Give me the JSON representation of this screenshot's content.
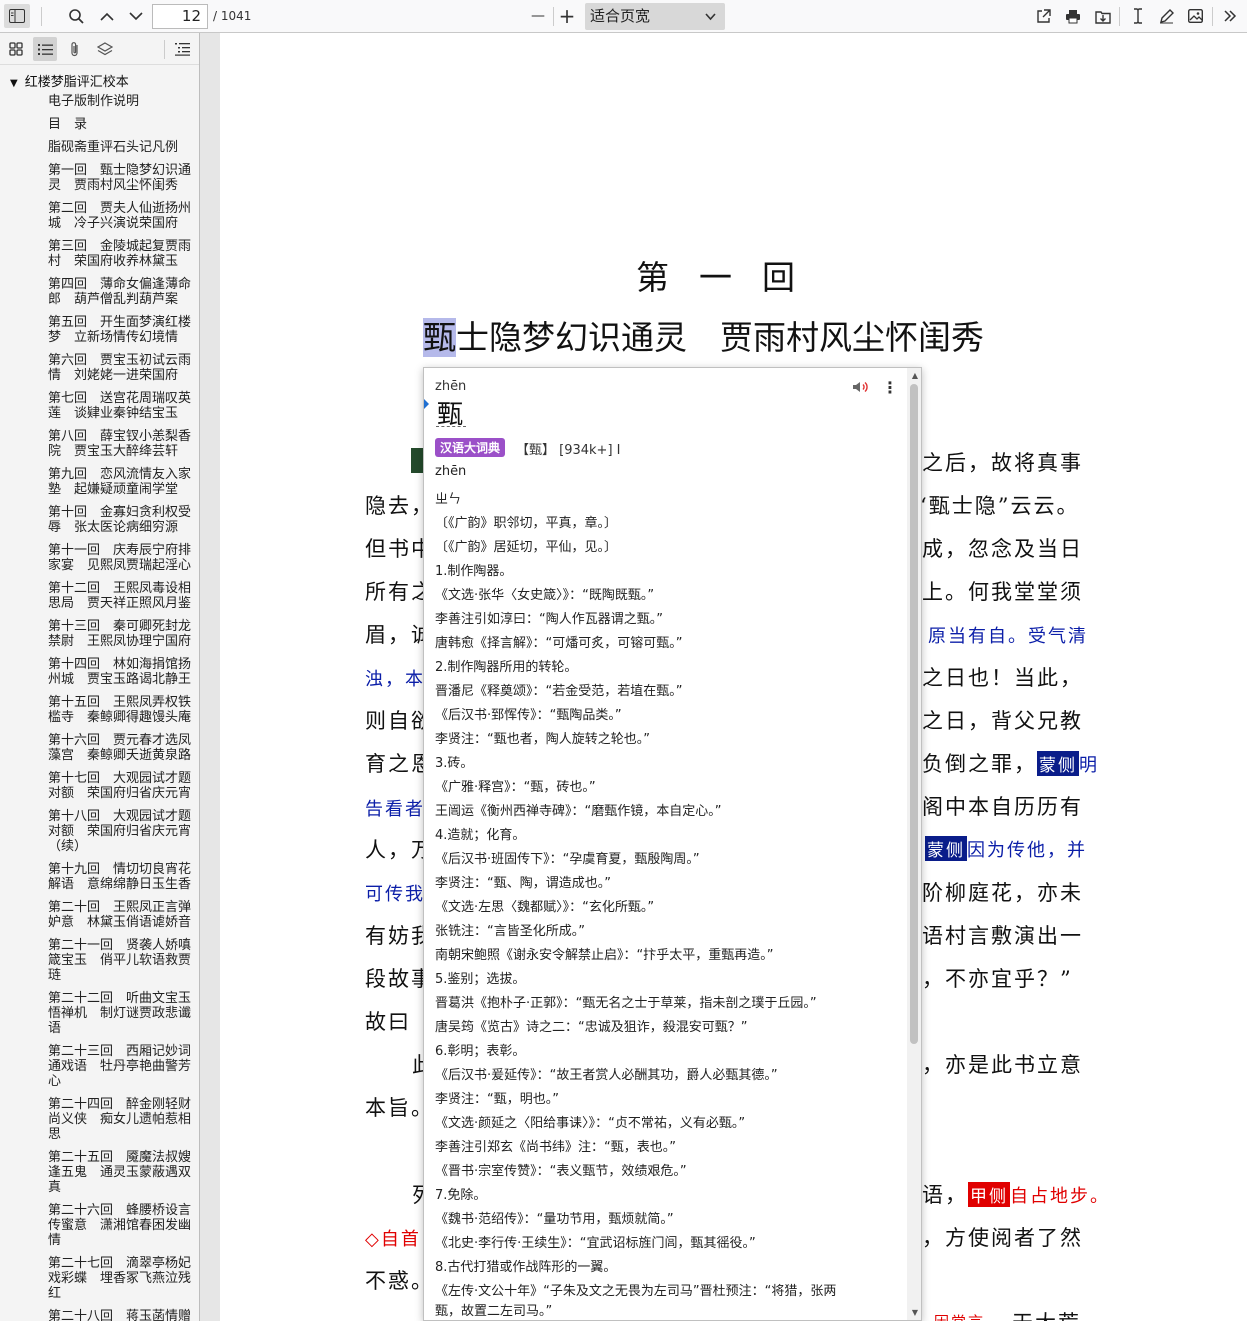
{
  "toolbar": {
    "page_current": "12",
    "page_total": "/ 1041",
    "zoom_minus": "—",
    "zoom_plus": "+",
    "zoom_value": "适合页宽"
  },
  "sidebar": {
    "root": "红楼梦脂评汇校本",
    "items": [
      "电子版制作说明",
      "目　录",
      "脂砚斋重评石头记凡例",
      "第一回　甄士隐梦幻识通灵　贾雨村风尘怀闺秀",
      "第二回　贾夫人仙逝扬州城　冷子兴演说荣国府",
      "第三回　金陵城起复贾雨村　荣国府收养林黛玉",
      "第四回　薄命女偏逢薄命郎　葫芦僧乱判葫芦案",
      "第五回　开生面梦演红楼梦　立新场情传幻境情",
      "第六回　贾宝玉初试云雨情　刘姥姥一进荣国府",
      "第七回　送宫花周瑞叹英莲　谈肄业秦钟结宝玉",
      "第八回　薛宝钗小恙梨香院　贾宝玉大醉绛芸轩",
      "第九回　恋风流情友入家塾　起嫌疑顽童闹学堂",
      "第十回　金寡妇贪利权受辱　张太医论病细穷源",
      "第十一回　庆寿辰宁府排家宴　见熙凤贾瑞起淫心",
      "第十二回　王熙凤毒设相思局　贾天祥正照风月鉴",
      "第十三回　秦可卿死封龙禁尉　王熙凤协理宁国府",
      "第十四回　林如海捐馆扬州城　贾宝玉路谒北静王",
      "第十五回　王熙凤弄权铁槛寺　秦鲸卿得趣馒头庵",
      "第十六回　贾元春才选凤藻宫　秦鲸卿夭逝黄泉路",
      "第十七回　大观园试才题对额　荣国府归省庆元宵",
      "第十八回　大观园试才题对额　荣国府归省庆元宵（续）",
      "第十九回　情切切良宵花解语　意绵绵静日玉生香",
      "第二十回　王熙凤正言弹妒意　林黛玉俏语谑娇音",
      "第二十一回　贤袭人娇嗔箴宝玉　俏平儿软语救贾琏",
      "第二十二回　听曲文宝玉悟禅机　制灯谜贾政悲谶语",
      "第二十三回　西厢记妙词通戏语　牡丹亭艳曲警芳心",
      "第二十四回　醉金刚轻财尚义侠　痴女儿遗帕惹相思",
      "第二十五回　魇魔法叔嫂逢五鬼　通灵玉蒙蔽遇双真",
      "第二十六回　蜂腰桥设言传蜜意　潇湘馆春困发幽情",
      "第二十七回　滴翠亭杨妃戏彩蝶　埋香冢飞燕泣残红",
      "第二十八回　蒋玉菡情赠"
    ]
  },
  "document": {
    "chapter_number": "第一回",
    "title_highlight": "甄",
    "title_rest": "士隐梦幻识通灵　贾雨村风尘怀闺秀",
    "lines": [
      "之后，故将真事",
      "隐去，",
      "“甄士隐”云云。",
      "但书中",
      "成，忽念及当日",
      "所有之",
      "上。何我堂堂须",
      "眉，诚",
      "原当有自。受气清",
      "浊，本",
      "之日也！当此，",
      "则自欲",
      "之日，背父兄教",
      "育之恩",
      "负倒之罪，",
      "蒙侧",
      "明",
      "告看者",
      "阁中本自历历有",
      "人，万",
      "蒙侧",
      "因为传他，并",
      "可传我",
      "阶柳庭花，亦未",
      "有妨我",
      "语村言敷演出一",
      "段故事",
      "，不亦宜乎？”",
      "故曰",
      "此",
      "，亦是此书立意",
      "本旨。",
      "列",
      "语，",
      "甲侧",
      "自占地步。",
      "◇自首",
      "，方使阅者了然",
      "不惑。",
      "因常言",
      "天大荒"
    ]
  },
  "popup": {
    "pinyin": "zhēn",
    "char": "甄",
    "source_badge": "汉语大词典",
    "entry_head": "【甄】 [934k+] I",
    "lines": [
      "zhēn",
      "ㄓㄣ",
      "〔《广韵》职邻切，平真，章。〕",
      "〔《广韵》居延切，平仙，见。〕",
      "1.制作陶器。",
      "《文选·张华〈女史箴〉》：“既陶既甄。”",
      "李善注引如淳曰：“陶人作瓦器谓之甄。”",
      "唐韩愈《择言解》：“可燔可炙，可镕可甄。”",
      "2.制作陶器所用的转轮。",
      "晋潘尼《释奠颂》：“若金受范，若埴在甄。”",
      "《后汉书·郅恽传》：“甄陶品类。”",
      "李贤注：“甄也者，陶人旋转之轮也。”",
      "3.砖。",
      "《广雅·释宫》：“甄，砖也。”",
      "王闿运《衡州西禅寺碑》：“磨甄作镜，本自定心。”",
      "4.造就；化育。",
      "《后汉书·班固传下》：“孕虞育夏，甄殷陶周。”",
      "李贤注：“甄、陶，谓造成也。”",
      "《文选·左思〈魏都赋〉》：“玄化所甄。”",
      "张铣注：“言皆圣化所成。”",
      "南朝宋鲍照《谢永安令解禁止启》：“抃乎太平，重甄再造。”",
      "5.鉴别；选拔。",
      "晋葛洪《抱朴子·正郭》：“甄无名之士于草莱，指未剖之璞于丘园。”",
      "唐吴筠《览古》诗之二：“忠诚及狙诈，殺混安可甄？”",
      "6.彰明；表彰。",
      "《后汉书·爰延传》：“故王者赏人必酬其功，爵人必甄其德。”",
      "李贤注：“甄，明也。”",
      "《文选·颜延之〈阳给事诔〉》：“贞不常祐，义有必甄。”",
      "李善注引郑玄《尚书纬》注：“甄，表也。”",
      "《晋书·宗室传赞》：“表义甄节，效绩艰危。”",
      "7.免除。",
      "《魏书·范绍传》：“量功节用，甄烦就简。”",
      "《北史·李行传·王续生》：“宜武诏标旌门闾，甄其徭役。”",
      "8.古代打猎或作战阵形的一翼。",
      "《左传·文公十年》“子朱及文之无畏为左司马”晋杜预注：“将猎，张两",
      "甄，故置二左司马。”"
    ]
  }
}
